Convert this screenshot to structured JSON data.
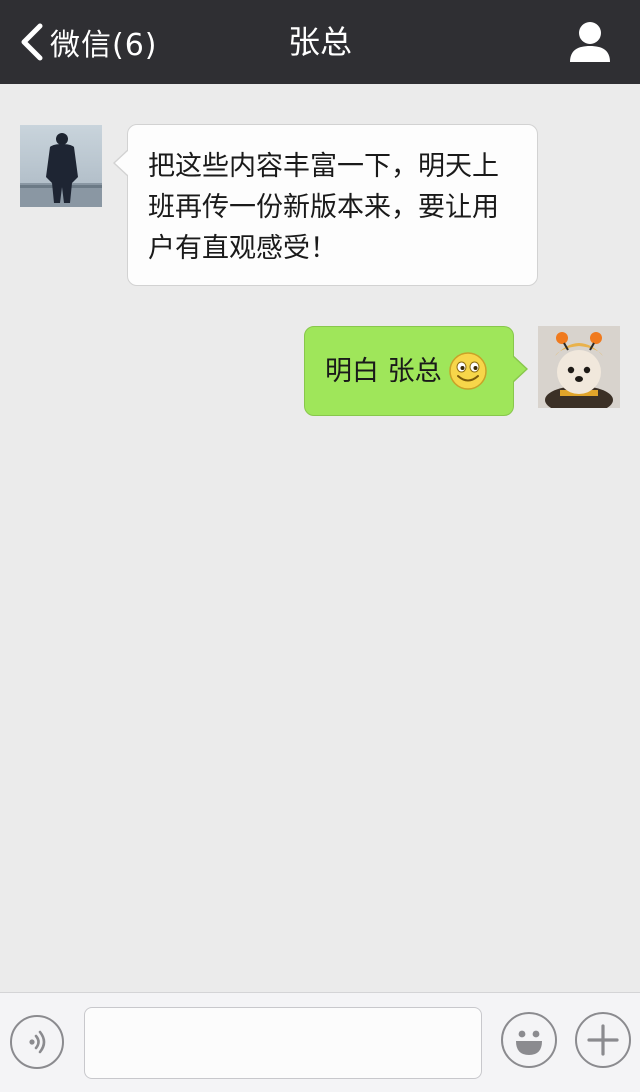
{
  "nav": {
    "back_label": "微信(6)",
    "title": "张总",
    "back_icon": "chevron-left-icon",
    "profile_icon": "person-icon",
    "background": "#2f2f33"
  },
  "messages": [
    {
      "direction": "incoming",
      "sender": "张总",
      "text": "把这些内容丰富一下，明天上班再传一份新版本来，要让用户有直观感受！",
      "bubble_color": "#fdfdfd"
    },
    {
      "direction": "outgoing",
      "text": "明白 张总",
      "emoji": "smile-emoji-icon",
      "bubble_color": "#9fe65a"
    }
  ],
  "input_bar": {
    "voice_icon": "voice-icon",
    "text_value": "",
    "emoji_icon": "emoji-icon",
    "plus_icon": "plus-icon"
  }
}
